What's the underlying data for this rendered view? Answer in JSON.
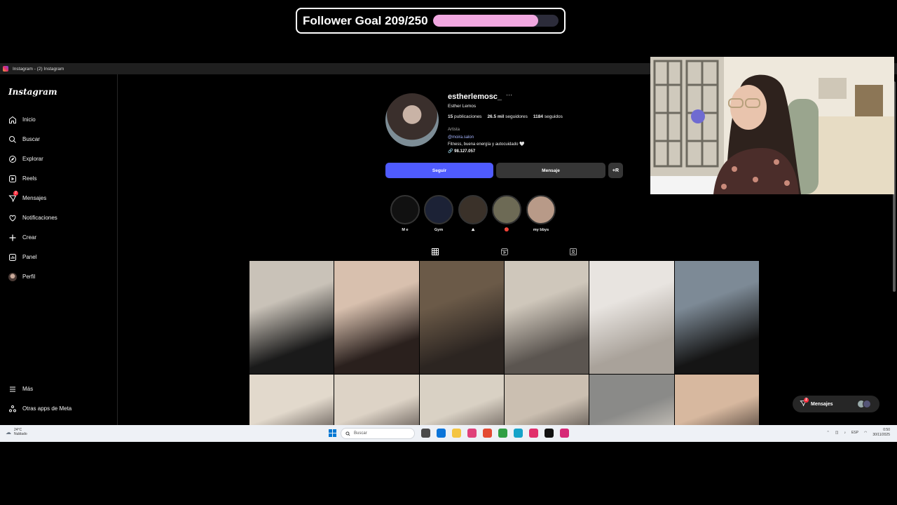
{
  "goal": {
    "label": "Follower Goal 209/250",
    "progress": 0.836,
    "fill_color": "#f1a7e0"
  },
  "browser": {
    "tab_title": "Instagram - (2) Instagram"
  },
  "sidebar": {
    "logo": "Instagram",
    "items": [
      {
        "label": "Inicio",
        "icon": "home-icon"
      },
      {
        "label": "Buscar",
        "icon": "search-icon"
      },
      {
        "label": "Explorar",
        "icon": "compass-icon"
      },
      {
        "label": "Reels",
        "icon": "reels-icon"
      },
      {
        "label": "Mensajes",
        "icon": "messenger-icon",
        "badge": "2"
      },
      {
        "label": "Notificaciones",
        "icon": "heart-icon"
      },
      {
        "label": "Crear",
        "icon": "plus-icon"
      },
      {
        "label": "Panel",
        "icon": "dashboard-icon"
      },
      {
        "label": "Perfil",
        "icon": "profile-avatar-icon"
      }
    ],
    "bottom_items": [
      {
        "label": "Más",
        "icon": "menu-icon"
      },
      {
        "label": "Otras apps de Meta",
        "icon": "meta-apps-icon"
      }
    ]
  },
  "profile": {
    "username": "estherlemosc_",
    "more": "···",
    "full_name": "Esther Lemos",
    "posts": "15",
    "posts_label": "publicaciones",
    "followers": "26.5 mil",
    "followers_label": "seguidores",
    "following": "1184",
    "following_label": "seguidos",
    "category": "Artista",
    "threads_handle": "@moira.salon",
    "bio": "Fitness, buena energía y autocuidado 🤍",
    "link": "98.127.057",
    "follow_button": "Seguir",
    "message_button": "Mensaje",
    "add_button": "+R"
  },
  "highlights": [
    {
      "label": "M e",
      "color": "#111"
    },
    {
      "label": "Gym",
      "color": "#1c2236"
    },
    {
      "label": "⛰",
      "color": "#3a3129"
    },
    {
      "label": "🔴",
      "color": "#6d6a55"
    },
    {
      "label": "my bbys",
      "color": "#b89a88"
    }
  ],
  "tabs": [
    {
      "name": "posts-tab",
      "icon": "grid-icon"
    },
    {
      "name": "reels-tab",
      "icon": "reels-icon"
    },
    {
      "name": "tagged-tab",
      "icon": "tagged-icon"
    }
  ],
  "posts": [
    {
      "colors": [
        "#c9c2b8",
        "#1a1a1a"
      ]
    },
    {
      "colors": [
        "#d8c0ae",
        "#2a201d"
      ]
    },
    {
      "colors": [
        "#6b5a48",
        "#2c2521"
      ]
    },
    {
      "colors": [
        "#cfc7bb",
        "#5b5550"
      ]
    },
    {
      "colors": [
        "#e8e4e0",
        "#a9a29a"
      ]
    },
    {
      "colors": [
        "#7d8a96",
        "#151515"
      ]
    },
    {
      "colors": [
        "#e2d9cc",
        "#2a2220"
      ]
    },
    {
      "colors": [
        "#ddd3c6",
        "#2b2321"
      ]
    },
    {
      "colors": [
        "#d9d1c4",
        "#3a302c"
      ]
    },
    {
      "colors": [
        "#cbbfb1",
        "#2a2523"
      ]
    },
    {
      "colors": [
        "#8a8a88",
        "#e8e1d6"
      ]
    },
    {
      "colors": [
        "#d7b89f",
        "#1a1412"
      ]
    }
  ],
  "messages_pill": {
    "label": "Mensajes",
    "badge": "2"
  },
  "taskbar": {
    "temp": "24°C",
    "weather": "Nublado",
    "search_placeholder": "Buscar",
    "lang": "ESP",
    "time": "0:50",
    "date": "30/11/2025",
    "apps": [
      "#4a4a4a",
      "#0b74d9",
      "#f4c542",
      "#e0417a",
      "#e34a33",
      "#2f9e44",
      "#15a3c9",
      "#e1306c",
      "#111111",
      "#d62976"
    ]
  }
}
